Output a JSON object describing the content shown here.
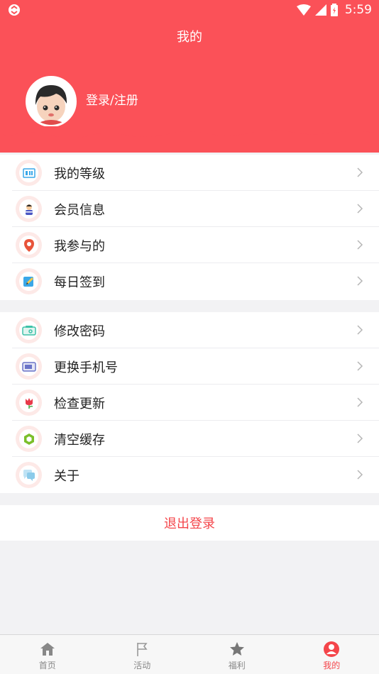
{
  "status_bar": {
    "time": "5:59"
  },
  "header": {
    "title": "我的",
    "login_label": "登录/注册"
  },
  "menu_group_1": [
    {
      "label": "我的等级",
      "icon": "level-icon"
    },
    {
      "label": "会员信息",
      "icon": "member-icon"
    },
    {
      "label": "我参与的",
      "icon": "location-pin-icon"
    },
    {
      "label": "每日签到",
      "icon": "signin-pencil-icon"
    }
  ],
  "menu_group_2": [
    {
      "label": "修改密码",
      "icon": "password-icon"
    },
    {
      "label": "更换手机号",
      "icon": "phone-icon"
    },
    {
      "label": "检查更新",
      "icon": "update-tulip-icon"
    },
    {
      "label": "清空缓存",
      "icon": "cache-hexagon-icon"
    },
    {
      "label": "关于",
      "icon": "about-chat-icon"
    }
  ],
  "logout_label": "退出登录",
  "bottom_nav": [
    {
      "label": "首页",
      "icon": "home-icon",
      "active": false
    },
    {
      "label": "活动",
      "icon": "flag-icon",
      "active": false
    },
    {
      "label": "福利",
      "icon": "star-icon",
      "active": false
    },
    {
      "label": "我的",
      "icon": "profile-icon",
      "active": true
    }
  ],
  "colors": {
    "primary": "#fb5158",
    "accent_text": "#f4454a"
  }
}
